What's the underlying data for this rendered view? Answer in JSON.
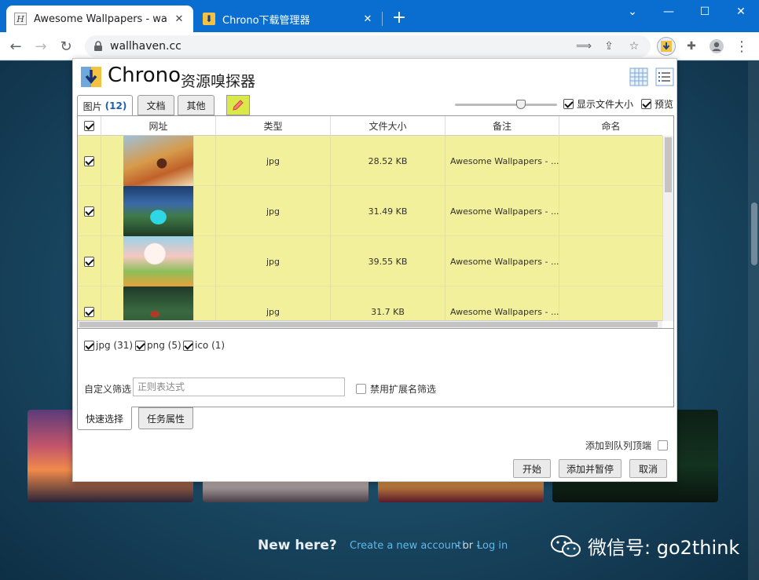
{
  "browser": {
    "tabs": [
      {
        "title": "Awesome Wallpapers - wallha",
        "active": true,
        "favicon_icon": "wallhaven-favicon"
      },
      {
        "title": "Chrono下载管理器",
        "active": false,
        "favicon_icon": "chrono-favicon"
      }
    ],
    "url": "wallhaven.cc",
    "accent": "#0a6ed1"
  },
  "popup": {
    "brand": "Chrono",
    "brand_sub": "资源嗅探器",
    "tabs": [
      {
        "label": "图片",
        "count": "(12)"
      },
      {
        "label": "文档"
      },
      {
        "label": "其他"
      }
    ],
    "options": {
      "show_size": "显示文件大小",
      "preview": "预览",
      "preview_zoom": 0.6
    },
    "columns": [
      "网址",
      "类型",
      "文件大小",
      "备注",
      "命名"
    ],
    "rows": [
      {
        "type": "jpg",
        "size": "28.52 KB",
        "note": "Awesome Wallpapers - ..."
      },
      {
        "type": "jpg",
        "size": "31.49 KB",
        "note": "Awesome Wallpapers - ..."
      },
      {
        "type": "jpg",
        "size": "39.55 KB",
        "note": "Awesome Wallpapers - ..."
      },
      {
        "type": "jpg",
        "size": "31.7 KB",
        "note": "Awesome Wallpapers - ..."
      }
    ],
    "filetypes": [
      {
        "label": "jpg (31)"
      },
      {
        "label": "png (5)"
      },
      {
        "label": "ico (1)"
      }
    ],
    "custom_filter": {
      "label": "自定义筛选",
      "placeholder": "正则表达式",
      "disable_ext": "禁用扩展名筛选"
    },
    "bottom_tabs": [
      "快速选择",
      "任务属性"
    ],
    "add_to_top": "添加到队列顶端",
    "buttons": {
      "start": "开始",
      "add_pause": "添加并暂停",
      "cancel": "取消"
    },
    "row_color": "#f2f09a"
  },
  "page": {
    "new_here": "New here?",
    "create": "Create a new account!",
    "or": "- or -",
    "login": "Log in",
    "watermark": "微信号: go2think"
  }
}
